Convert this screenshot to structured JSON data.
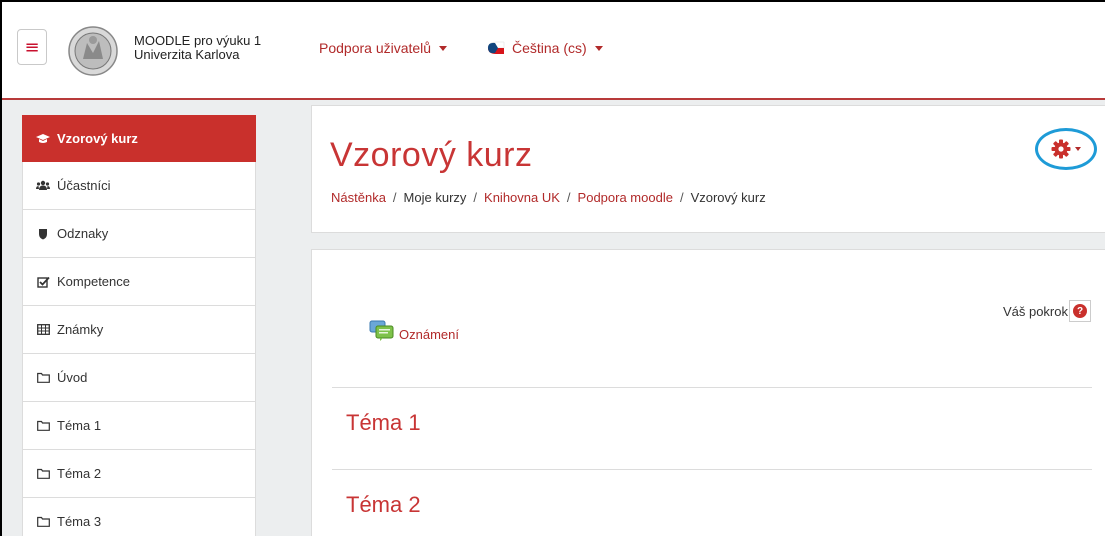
{
  "navbar": {
    "brand_line1": "MOODLE pro výuku 1",
    "brand_line2": "Univerzita Karlova",
    "support_menu": "Podpora uživatelů",
    "language_menu": "Čeština (cs)"
  },
  "sidebar": {
    "items": [
      {
        "label": "Vzorový kurz",
        "icon": "graduation-cap-icon"
      },
      {
        "label": "Účastníci",
        "icon": "users-icon"
      },
      {
        "label": "Odznaky",
        "icon": "shield-icon"
      },
      {
        "label": "Kompetence",
        "icon": "checkbox-icon"
      },
      {
        "label": "Známky",
        "icon": "table-icon"
      },
      {
        "label": "Úvod",
        "icon": "folder-icon"
      },
      {
        "label": "Téma 1",
        "icon": "folder-icon"
      },
      {
        "label": "Téma 2",
        "icon": "folder-icon"
      },
      {
        "label": "Téma 3",
        "icon": "folder-icon"
      }
    ]
  },
  "header": {
    "course_title": "Vzorový kurz",
    "breadcrumb": {
      "b0": "Nástěnka",
      "b1": "Moje kurzy",
      "b2": "Knihovna UK",
      "b3": "Podpora moodle",
      "b4": "Vzorový kurz",
      "separator": "/"
    },
    "help_glyph": "?"
  },
  "main": {
    "progress_label": "Váš pokrok",
    "announcements": "Oznámení",
    "topics": [
      "Téma 1",
      "Téma 2"
    ]
  },
  "colors": {
    "accent": "#c9302c",
    "link": "#b12a2a",
    "highlight_circle": "#1e9bd7"
  }
}
